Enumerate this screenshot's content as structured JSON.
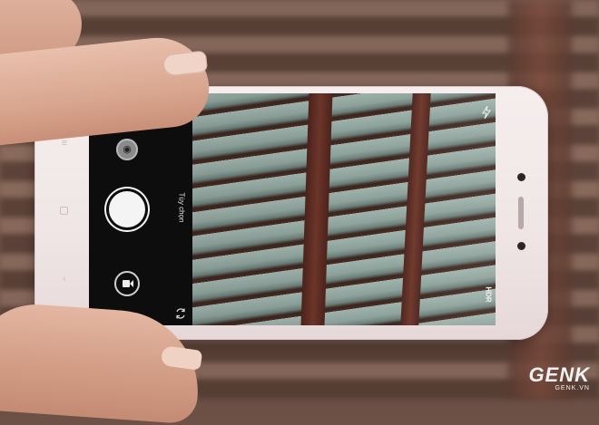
{
  "camera_ui": {
    "options_label": "Tùy chọn",
    "hdr_label": "HDR"
  },
  "watermark": {
    "logo": "GENK",
    "site": "GENK.VN"
  },
  "icons": {
    "filters": "filters-icon",
    "switch_camera": "switch-camera-icon",
    "flash": "flash-icon",
    "video": "video-camera-icon",
    "gallery": "gallery-thumbnail-icon"
  },
  "colors": {
    "phone_body": "#efe5e5",
    "camera_panel": "#0d0d0d",
    "shutter": "#f4f4f4"
  }
}
